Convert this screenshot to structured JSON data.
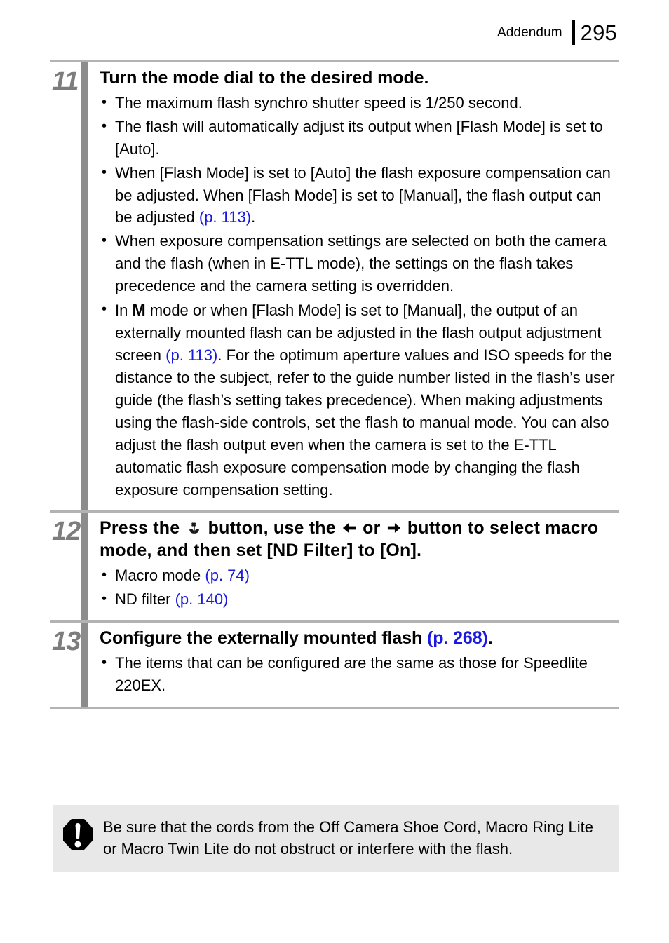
{
  "header": {
    "section_label": "Addendum",
    "page_number": "295"
  },
  "colors": {
    "reference_link": "#1a19e0",
    "step_number": "#7d7d7d",
    "step_bar": "#8c8c8c",
    "divider": "#b3b3b3",
    "warning_background": "#e8e8e8"
  },
  "steps": [
    {
      "number": "11",
      "title": "Turn the mode dial to the desired mode.",
      "bullets": [
        {
          "parts": [
            {
              "text": "The maximum flash synchro shutter speed is 1/250 second.",
              "style": "plain"
            }
          ]
        },
        {
          "parts": [
            {
              "text": "The flash will automatically adjust its output when [Flash Mode] is set to [Auto].",
              "style": "plain"
            }
          ]
        },
        {
          "parts": [
            {
              "text": "When [Flash Mode] is set to [Auto] the flash exposure compensation can be adjusted. When [Flash Mode] is set to [Manual], the flash output can be adjusted ",
              "style": "plain"
            },
            {
              "text": "(p. 113)",
              "style": "ref"
            },
            {
              "text": ".",
              "style": "plain"
            }
          ]
        },
        {
          "parts": [
            {
              "text": "When exposure compensation settings are selected on both the camera and the flash (when in E-TTL mode), the settings on the flash takes precedence and the camera setting is overridden.",
              "style": "plain"
            }
          ]
        },
        {
          "parts": [
            {
              "text": "In ",
              "style": "plain"
            },
            {
              "text": "M",
              "style": "glyph-m"
            },
            {
              "text": " mode or when [Flash Mode] is set to [Manual], the output of an externally mounted flash can be adjusted in the flash output adjustment screen ",
              "style": "plain"
            },
            {
              "text": "(p. 113)",
              "style": "ref"
            },
            {
              "text": ". For the optimum aperture values and ISO speeds for the distance to the subject, refer to the guide number listed in the flash’s user guide (the flash’s setting takes precedence). When making adjustments using the flash-side controls, set the flash to manual mode. You can also adjust the flash output even when the camera is set to the E-TTL automatic flash exposure compensation mode by changing the flash exposure compensation setting.",
              "style": "plain"
            }
          ]
        }
      ]
    },
    {
      "number": "12",
      "title_parts": [
        {
          "text": "Press the ",
          "style": "plain"
        },
        {
          "text": "macro-flower-icon",
          "style": "icon-macro"
        },
        {
          "text": " button, use the ",
          "style": "plain"
        },
        {
          "text": "arrow-left-icon",
          "style": "icon-arrow-left"
        },
        {
          "text": " or ",
          "style": "plain"
        },
        {
          "text": "arrow-right-icon",
          "style": "icon-arrow-right"
        },
        {
          "text": " button to select macro mode, and then set [ND Filter] to [On].",
          "style": "plain"
        }
      ],
      "bullets": [
        {
          "parts": [
            {
              "text": "Macro mode ",
              "style": "plain"
            },
            {
              "text": "(p. 74)",
              "style": "ref"
            }
          ]
        },
        {
          "parts": [
            {
              "text": "ND filter ",
              "style": "plain"
            },
            {
              "text": "(p. 140)",
              "style": "ref"
            }
          ]
        }
      ]
    },
    {
      "number": "13",
      "title_parts": [
        {
          "text": "Configure the externally mounted flash ",
          "style": "plain"
        },
        {
          "text": "(p. 268)",
          "style": "ref-bold"
        },
        {
          "text": ".",
          "style": "plain"
        }
      ],
      "bullets": [
        {
          "parts": [
            {
              "text": "The items that can be configured are the same as those for Speedlite 220EX.",
              "style": "plain"
            }
          ]
        }
      ]
    }
  ],
  "warning": {
    "icon": "exclamation-octagon-icon",
    "text": "Be sure that the cords from the Off Camera Shoe Cord, Macro Ring Lite or Macro Twin Lite do not obstruct or interfere with the flash."
  }
}
